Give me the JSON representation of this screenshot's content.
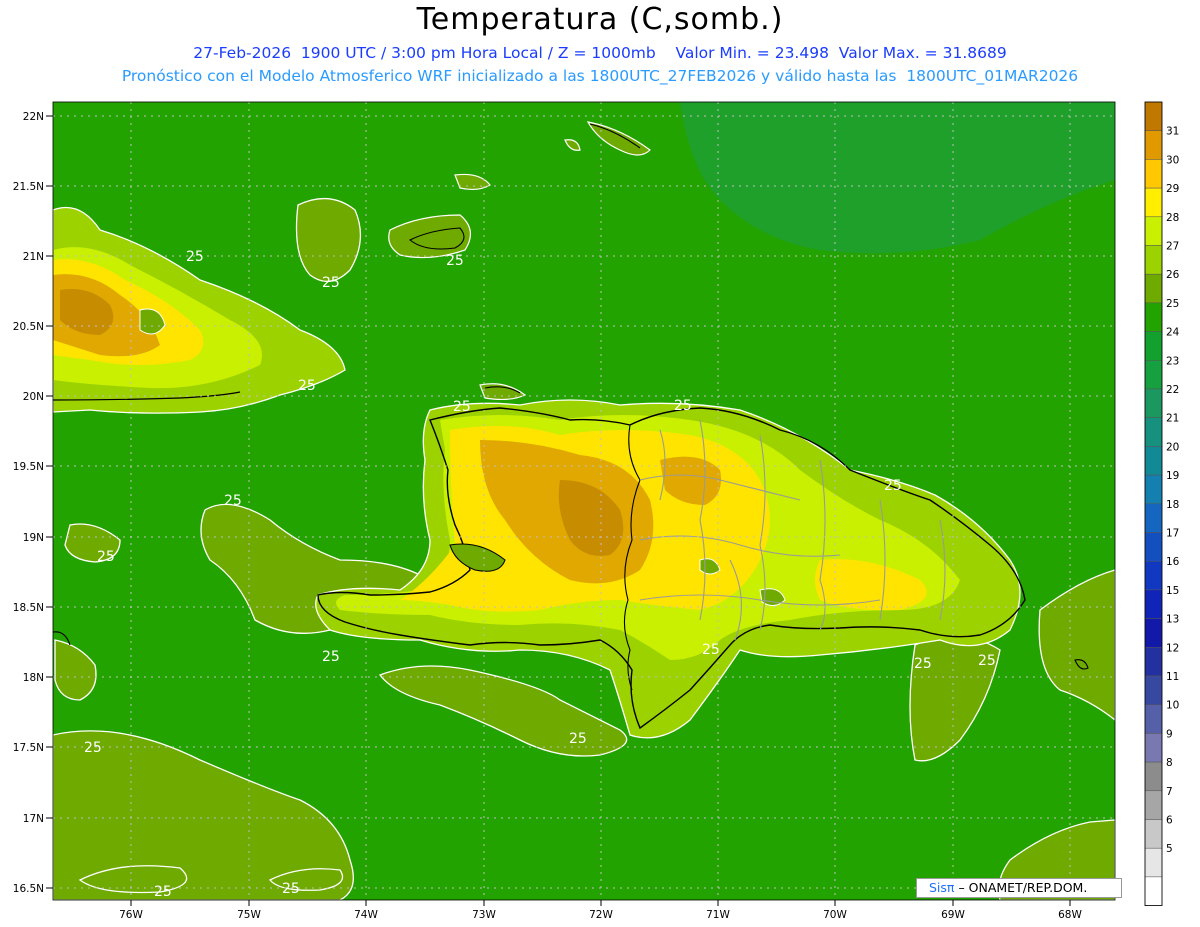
{
  "title": "Temperatura (C,somb.)",
  "subtitle_line1": "27-Feb-2026  1900 UTC / 3:00 pm Hora Local / Z = 1000mb    Valor Min. = 23.498  Valor Max. = 31.8689",
  "subtitle_line2": "Pronóstico con el Modelo Atmosferico WRF inicializado a las 1800UTC_27FEB2026 y válido hasta las  1800UTC_01MAR2026",
  "lat_labels": [
    "22N",
    "21.5N",
    "21N",
    "20.5N",
    "20N",
    "19.5N",
    "19N",
    "18.5N",
    "18N",
    "17.5N",
    "17N",
    "16.5N"
  ],
  "lon_labels": [
    "76W",
    "75W",
    "74W",
    "73W",
    "72W",
    "71W",
    "70W",
    "69W",
    "68W"
  ],
  "contour_label": "25",
  "legend": {
    "labels": [
      "31",
      "30",
      "29",
      "28",
      "27",
      "26",
      "25",
      "24",
      "23",
      "22",
      "21",
      "20",
      "19",
      "18",
      "17",
      "16",
      "15",
      "13",
      "12",
      "11",
      "10",
      "9",
      "8",
      "7",
      "6",
      "5"
    ],
    "colors": [
      "#c07800",
      "#e09a00",
      "#ffc800",
      "#ffee00",
      "#c8f000",
      "#9cd200",
      "#6eaa00",
      "#23a300",
      "#12a12e",
      "#17a03f",
      "#1a9860",
      "#16917d",
      "#128a95",
      "#1380b0",
      "#1566c0",
      "#1250c0",
      "#1038c0",
      "#1024b8",
      "#1218a8",
      "#2230a0",
      "#3648a0",
      "#5660a8",
      "#7a78b0",
      "#8c8c8c",
      "#a6a6a6",
      "#c8c8c8",
      "#e6e6e6",
      "#ffffff"
    ]
  },
  "credit": {
    "brand": "Sisπ",
    "text": "– ONAMET/REP.DOM."
  },
  "colors": {
    "ocean": "#23a300",
    "land_low": "#6eaa00",
    "land_mid": "#9cd200",
    "land_warm": "#c8f000",
    "land_hot": "#ffe400",
    "land_hotter": "#e0a800",
    "land_hottest": "#c88c00",
    "coast": "#000000",
    "borders": "#9a9a9a",
    "grid": "#bfbfbf"
  }
}
